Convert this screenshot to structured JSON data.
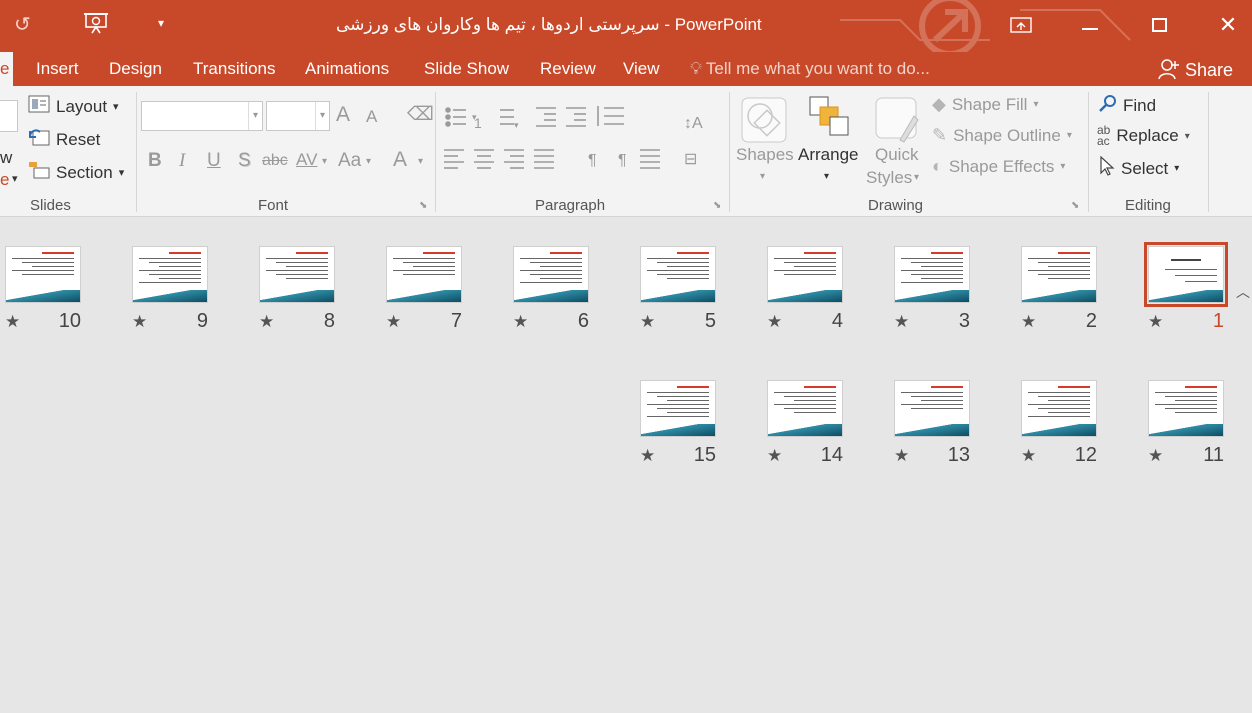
{
  "window": {
    "title": "سرپرستی اردوها ، تیم ها وکاروان های ورزشی - PowerPoint"
  },
  "quick_access": {
    "undo_icon": "undo-icon",
    "presenter_icon": "presentation-icon",
    "customize_icon": "dropdown-icon"
  },
  "tabs": [
    {
      "label": "e"
    },
    {
      "label": "Insert"
    },
    {
      "label": "Design"
    },
    {
      "label": "Transitions"
    },
    {
      "label": "Animations"
    },
    {
      "label": "Slide Show"
    },
    {
      "label": "Review"
    },
    {
      "label": "View"
    }
  ],
  "tellme": {
    "placeholder": "Tell me what you want to do..."
  },
  "share": {
    "label": "Share"
  },
  "ribbon": {
    "slides": {
      "label": "Slides",
      "partial_w": "w",
      "partial_e": "e",
      "layout": "Layout",
      "reset": "Reset",
      "section": "Section"
    },
    "font": {
      "label": "Font",
      "name_value": "",
      "size_value": "",
      "bold": "B",
      "italic": "I",
      "underline": "U",
      "shadow": "S",
      "strike": "abc",
      "spacing": "AV",
      "case": "Aa",
      "grow": "A",
      "shrink": "A",
      "color": "A"
    },
    "paragraph": {
      "label": "Paragraph"
    },
    "drawing": {
      "label": "Drawing",
      "shapes": "Shapes",
      "arrange": "Arrange",
      "quick_styles_1": "Quick",
      "quick_styles_2": "Styles",
      "shape_fill": "Shape Fill",
      "shape_outline": "Shape Outline",
      "shape_effects": "Shape Effects"
    },
    "editing": {
      "label": "Editing",
      "find": "Find",
      "replace": "Replace",
      "select": "Select"
    }
  },
  "slides": [
    {
      "number": "1",
      "selected": true
    },
    {
      "number": "2"
    },
    {
      "number": "3"
    },
    {
      "number": "4"
    },
    {
      "number": "5"
    },
    {
      "number": "6"
    },
    {
      "number": "7"
    },
    {
      "number": "8"
    },
    {
      "number": "9"
    },
    {
      "number": "10"
    },
    {
      "number": "11"
    },
    {
      "number": "12"
    },
    {
      "number": "13"
    },
    {
      "number": "14"
    },
    {
      "number": "15"
    }
  ],
  "transition_marker": "★",
  "colors": {
    "accent": "#c8492a",
    "slide_band": "#0d4d63"
  }
}
